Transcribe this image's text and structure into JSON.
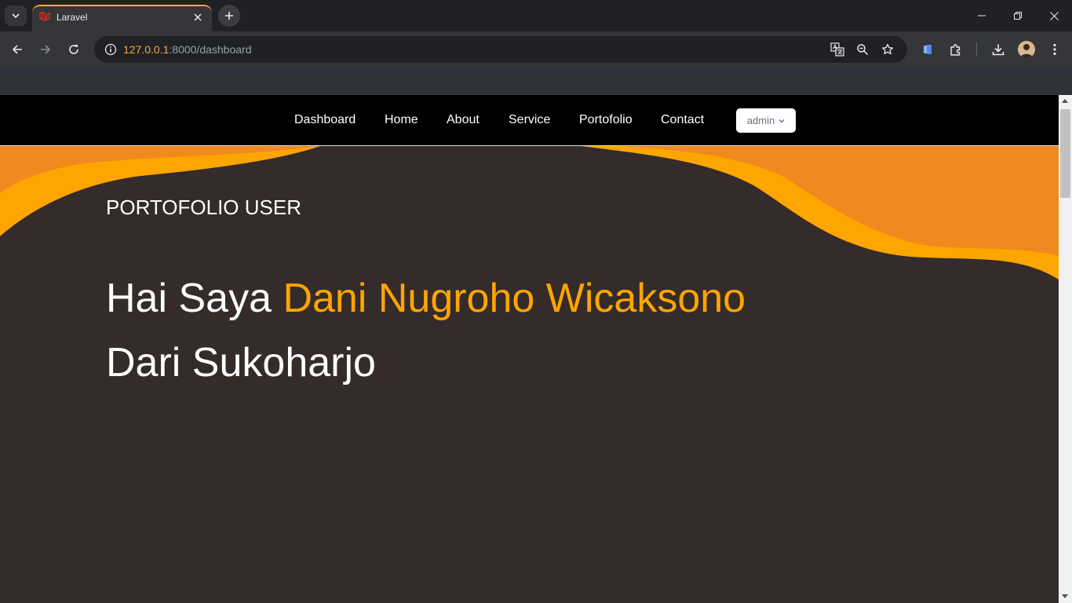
{
  "browser": {
    "tab": {
      "title": "Laravel",
      "favicon": "laravel-icon"
    },
    "address": {
      "host": "127.0.0.1",
      "rest": ":8000/dashboard"
    },
    "icons": [
      "tab-search-icon",
      "close-icon",
      "plus-icon",
      "minimize-icon",
      "restore-icon",
      "close-window-icon",
      "back-arrow-icon",
      "forward-arrow-icon",
      "reload-icon",
      "info-icon",
      "translate-icon",
      "zoom-icon",
      "star-icon",
      "tab-organizer-icon",
      "extensions-icon",
      "download-icon",
      "profile-icon",
      "more-icon"
    ]
  },
  "nav": {
    "links": [
      "Dashboard",
      "Home",
      "About",
      "Service",
      "Portofolio",
      "Contact"
    ],
    "user": "admin"
  },
  "hero": {
    "label": "PORTOFOLIO USER",
    "greeting": "Hai Saya ",
    "name": "Dani Nugroho Wicaksono",
    "origin": "Dari Sukoharjo"
  },
  "colors": {
    "accent": "#ffa500",
    "wave_dark": "#ef8a1e",
    "background": "#342b2a",
    "navbar": "#000000"
  }
}
